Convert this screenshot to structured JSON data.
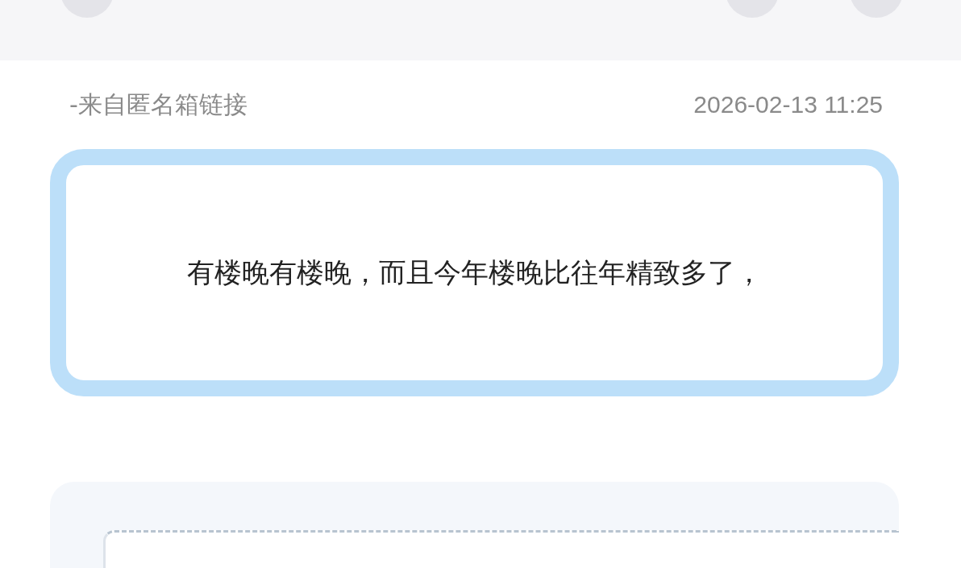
{
  "source": "-来自匿名箱链接",
  "timestamp": "2026-02-13 11:25",
  "message": "有楼晚有楼晚，而且今年楼晚比往年精致多了，"
}
